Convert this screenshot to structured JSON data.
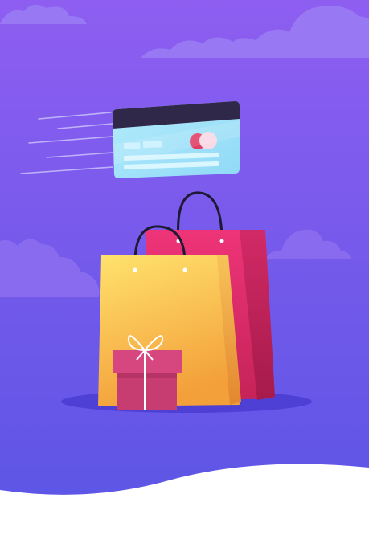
{
  "scene": {
    "description_colors": {
      "background_top": "#8B5CF0",
      "background_bottom": "#5B55E6",
      "cloud": "#9A7BF2",
      "floor_wave": "#FFFFFF",
      "card_body": "#A8E6FB",
      "card_stripe": "#2E2746",
      "card_logo_red": "#E23D63",
      "card_logo_pink": "#F7D7E3",
      "bag_yellow_top": "#FFE36B",
      "bag_yellow_bottom": "#F4A23A",
      "bag_pink_top": "#F0357A",
      "bag_pink_bottom": "#B51F53",
      "gift_box": "#CF3F77",
      "ribbon": "#FFFFFF",
      "shadow": "#4E3FD6"
    },
    "icons": [
      "credit-card-icon",
      "shopping-bag-icon",
      "gift-box-icon",
      "cloud-icon"
    ]
  }
}
